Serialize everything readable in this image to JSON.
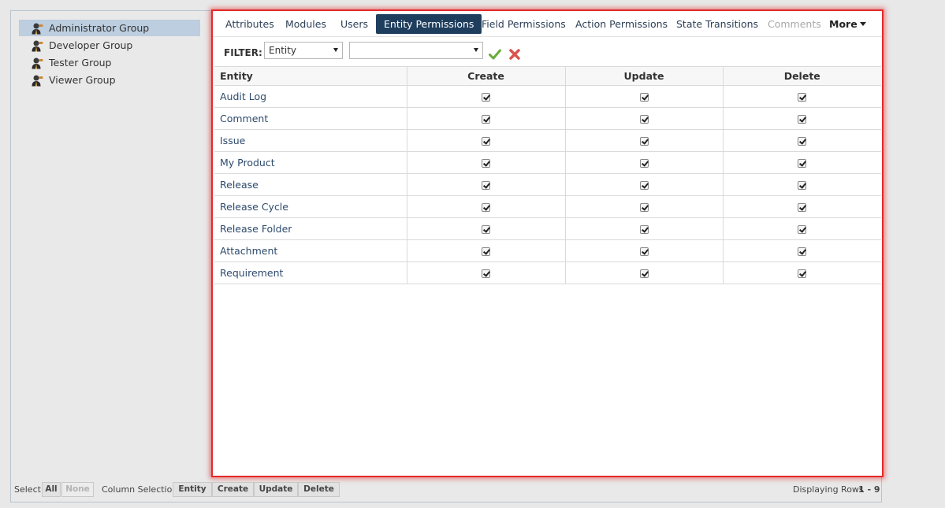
{
  "groups": [
    {
      "label": "Administrator Group",
      "selected": true
    },
    {
      "label": "Developer Group"
    },
    {
      "label": "Tester Group"
    },
    {
      "label": "Viewer Group"
    }
  ],
  "tabs": {
    "attributes": "Attributes",
    "modules": "Modules",
    "users": "Users",
    "entity_permissions": "Entity Permissions",
    "field_permissions": "Field Permissions",
    "action_permissions": "Action Permissions",
    "state_transitions": "State Transitions",
    "comments": "Comments",
    "more": "More"
  },
  "filter": {
    "label": "FILTER:",
    "field_value": "Entity",
    "value_selected": ""
  },
  "table": {
    "headers": {
      "entity": "Entity",
      "create": "Create",
      "update": "Update",
      "delete": "Delete"
    },
    "rows": [
      {
        "entity": "Audit Log",
        "create": true,
        "update": true,
        "delete": true
      },
      {
        "entity": "Comment",
        "create": true,
        "update": true,
        "delete": true
      },
      {
        "entity": "Issue",
        "create": true,
        "update": true,
        "delete": true
      },
      {
        "entity": "My Product",
        "create": true,
        "update": true,
        "delete": true
      },
      {
        "entity": "Release",
        "create": true,
        "update": true,
        "delete": true
      },
      {
        "entity": "Release Cycle",
        "create": true,
        "update": true,
        "delete": true
      },
      {
        "entity": "Release Folder",
        "create": true,
        "update": true,
        "delete": true
      },
      {
        "entity": "Attachment",
        "create": true,
        "update": true,
        "delete": true
      },
      {
        "entity": "Requirement",
        "create": true,
        "update": true,
        "delete": true
      }
    ]
  },
  "footer": {
    "select_label": "Select",
    "all": "All",
    "none": "None",
    "column_selection_label": "Column Selection:",
    "col_entity": "Entity",
    "col_create": "Create",
    "col_update": "Update",
    "col_delete": "Delete",
    "displaying_label": "Displaying Rows",
    "displaying_range": "1 - 9"
  },
  "colors": {
    "active_tab": "#1f3e5e",
    "selected_group": "#bccedf",
    "highlight_border": "#e42a2a",
    "apply_icon": "#6aaa3a",
    "clear_icon": "#d9534f"
  }
}
